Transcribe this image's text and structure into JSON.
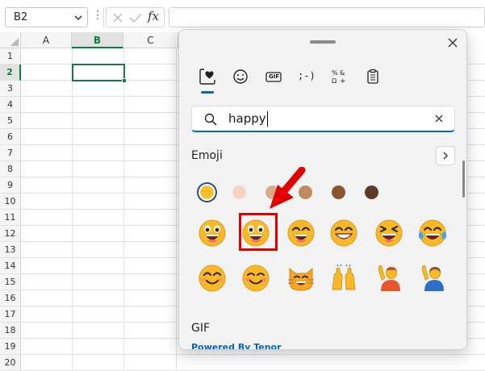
{
  "formula_bar": {
    "name_box_value": "B2",
    "more_glyph": "⋮",
    "fx_label": "fx",
    "formula_value": ""
  },
  "sheet": {
    "columns": [
      "A",
      "B",
      "C"
    ],
    "selected_column": "B",
    "rows": [
      "1",
      "2",
      "3",
      "4",
      "5",
      "6",
      "7",
      "8",
      "9",
      "10",
      "11",
      "12",
      "13",
      "14",
      "15",
      "16",
      "17",
      "18",
      "19",
      "20"
    ],
    "selected_row": "2",
    "active_cell": "B2"
  },
  "emoji_panel": {
    "tabs": [
      {
        "id": "emoji",
        "icon": "heart-face-icon",
        "selected": true
      },
      {
        "id": "kaomoji-face",
        "icon": "smiley-icon",
        "selected": false
      },
      {
        "id": "gif",
        "icon": "gif-icon",
        "label": "GIF",
        "selected": false
      },
      {
        "id": "kaomoji",
        "icon": "kaomoji-icon",
        "label": ";-)",
        "selected": false
      },
      {
        "id": "symbols",
        "icon": "symbols-icon",
        "selected": false
      },
      {
        "id": "clipboard",
        "icon": "clipboard-icon",
        "selected": false
      }
    ],
    "search": {
      "value": "happy",
      "placeholder": ""
    },
    "emoji_section_title": "Emoji",
    "skin_tones": [
      "#f7c02c",
      "#f6d3c2",
      "#d9a98b",
      "#c08b63",
      "#8a5530",
      "#5b3a2a"
    ],
    "selected_skin_tone": 0,
    "emoji_rows": [
      [
        "grinning-squinting-face",
        "grinning-face-big-eyes",
        "grinning-face-smiling-eyes",
        "beaming-face",
        "laughing-face",
        "face-with-tears-of-joy"
      ],
      [
        "smiling-face-smiling-eyes",
        "smiling-blushing-face",
        "grinning-cat",
        "raising-hands",
        "person-raising-hand",
        "person-raising-hand-2"
      ]
    ],
    "highlighted_emoji": "grinning-face-big-eyes",
    "gif_section_title": "GIF",
    "powered_by": "Powered By Tenor"
  },
  "colors": {
    "excel_green": "#107c41",
    "accent_blue": "#0067c0",
    "highlight_red": "#e00000",
    "emoji_yellow": "#f7b928"
  }
}
